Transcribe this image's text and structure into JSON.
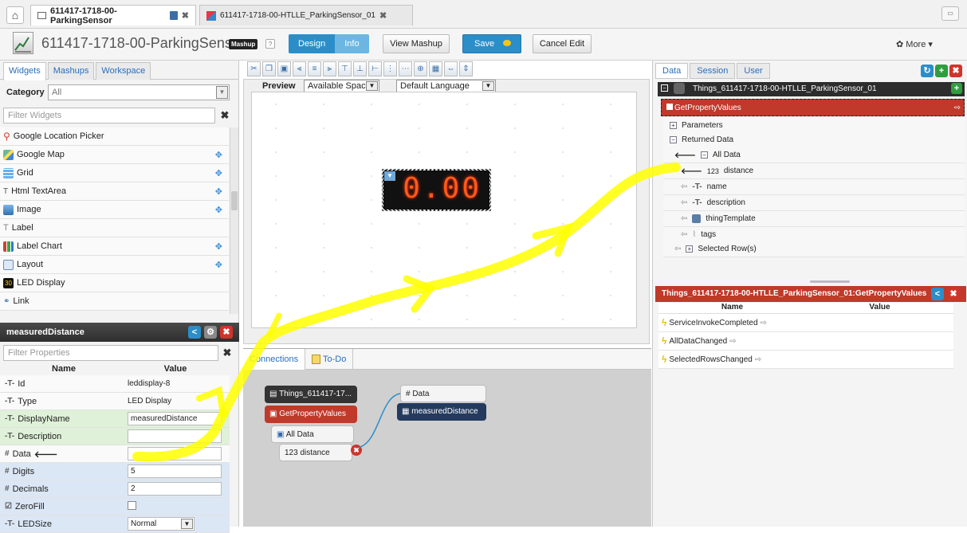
{
  "tabs": [
    {
      "label": "611417-1718-00-ParkingSensor",
      "active": true
    },
    {
      "label": "611417-1718-00-HTLLE_ParkingSensor_01",
      "active": false
    }
  ],
  "header": {
    "title": "611417-1718-00-ParkingSensor",
    "badge": "Mashup",
    "help": "?",
    "design_label": "Design",
    "info_label": "Info",
    "view_mashup": "View Mashup",
    "save": "Save",
    "cancel_edit": "Cancel Edit",
    "more": "More"
  },
  "left": {
    "tabs": [
      "Widgets",
      "Mashups",
      "Workspace"
    ],
    "category_label": "Category",
    "category_value": "All",
    "filter_placeholder": "Filter Widgets",
    "widgets": [
      "Google Location Picker",
      "Google Map",
      "Grid",
      "Html TextArea",
      "Image",
      "Label",
      "Label Chart",
      "Layout",
      "LED Display",
      "Link"
    ],
    "props_title": "measuredDistance",
    "filter_props_placeholder": "Filter Properties",
    "col_name": "Name",
    "col_value": "Value",
    "props": [
      {
        "icon": "T",
        "name": "Id",
        "value": "leddisplay-8"
      },
      {
        "icon": "T",
        "name": "Type",
        "value": "LED Display"
      },
      {
        "icon": "T",
        "name": "DisplayName",
        "value": "measuredDistance"
      },
      {
        "icon": "T",
        "name": "Description",
        "value": ""
      },
      {
        "icon": "#",
        "name": "Data",
        "value": ""
      },
      {
        "icon": "#",
        "name": "Digits",
        "value": "5"
      },
      {
        "icon": "#",
        "name": "Decimals",
        "value": "2"
      },
      {
        "icon": "?",
        "name": "ZeroFill",
        "value": ""
      },
      {
        "icon": "T",
        "name": "LEDSize",
        "value": "Normal"
      }
    ]
  },
  "center": {
    "preview_label": "Preview",
    "space_select": "Available Space",
    "language_select": "Default Language",
    "led_value": "0.00",
    "conn_tabs": [
      "Connections",
      "To-Do"
    ],
    "nodes": {
      "thing": "Things_611417-17...",
      "service": "GetPropertyValues",
      "alldata": "All Data",
      "distance": "123 distance",
      "data_target": "# Data",
      "widget": "measuredDistance"
    }
  },
  "right": {
    "tabs": [
      "Data",
      "Session",
      "User"
    ],
    "thing_title": "Things_611417-1718-00-HTLLE_ParkingSensor_01",
    "service": "GetPropertyValues",
    "tree": {
      "parameters": "Parameters",
      "returned": "Returned Data",
      "alldata": "All Data",
      "fields": [
        {
          "icon": "123",
          "name": "distance"
        },
        {
          "icon": "T",
          "name": "name"
        },
        {
          "icon": "T",
          "name": "description"
        },
        {
          "icon": "tpl",
          "name": "thingTemplate"
        },
        {
          "icon": "tag",
          "name": "tags"
        }
      ],
      "selected": "Selected Row(s)"
    },
    "events_title": "Things_611417-1718-00-HTLLE_ParkingSensor_01:GetPropertyValues",
    "col_name": "Name",
    "col_value": "Value",
    "events": [
      "ServiceInvokeCompleted",
      "AllDataChanged",
      "SelectedRowsChanged"
    ]
  }
}
